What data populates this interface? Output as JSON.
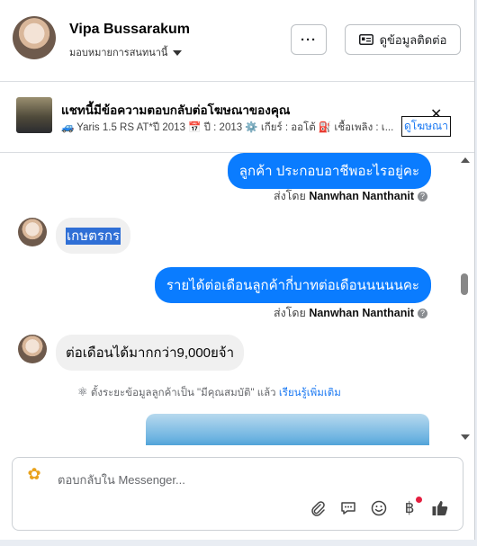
{
  "contact": {
    "name": "Vipa Bussarakum",
    "assign_label": "มอบหมายการสนทนานี้"
  },
  "header": {
    "more_label": "···",
    "contact_info_label": "ดูข้อมูลติดต่อ"
  },
  "ad_banner": {
    "title": "แชทนี้มีข้อความตอบกลับต่อโฆษณาของคุณ",
    "description": "🚙 Yaris 1.5 RS AT*ปี 2013 📅 ปี : 2013 ⚙️ เกียร์ : ออโต้ ⛽ เชื้อเพลิง : เ...",
    "link_label": "ดูโฆษณา",
    "close_icon": "close-icon"
  },
  "messages": [
    {
      "direction": "out",
      "text": "ลูกค้า ประกอบอาชีพอะไรอยู่คะ",
      "sent_by_prefix": "ส่งโดย",
      "sent_by_name": "Nanwhan Nanthanit"
    },
    {
      "direction": "in",
      "text": "เกษตรกร",
      "highlighted": true
    },
    {
      "direction": "out",
      "text": "รายได้ต่อเดือนลูกค้ากี่บาทต่อเดือนนนนนคะ",
      "sent_by_prefix": "ส่งโดย",
      "sent_by_name": "Nanwhan Nanthanit"
    },
    {
      "direction": "in",
      "text": "ต่อเดือนได้มากกว่า9,000ยจ้า"
    }
  ],
  "system_notice": {
    "text": "ตั้งระยะข้อมูลลูกค้าเป็น \"มีคุณสมบัติ\" แล้ว",
    "link": "เรียนรู้เพิ่มเติม"
  },
  "composer": {
    "placeholder": "ตอบกลับใน Messenger...",
    "tools": [
      "paperclip-icon",
      "chat-bubble-icon",
      "smiley-icon",
      "baht-icon",
      "thumbs-up-icon"
    ]
  },
  "colors": {
    "outgoing_bubble": "#0a7cff",
    "incoming_bubble": "#f0f0f0",
    "link": "#1877f2",
    "notification_dot": "#e41e3f"
  }
}
